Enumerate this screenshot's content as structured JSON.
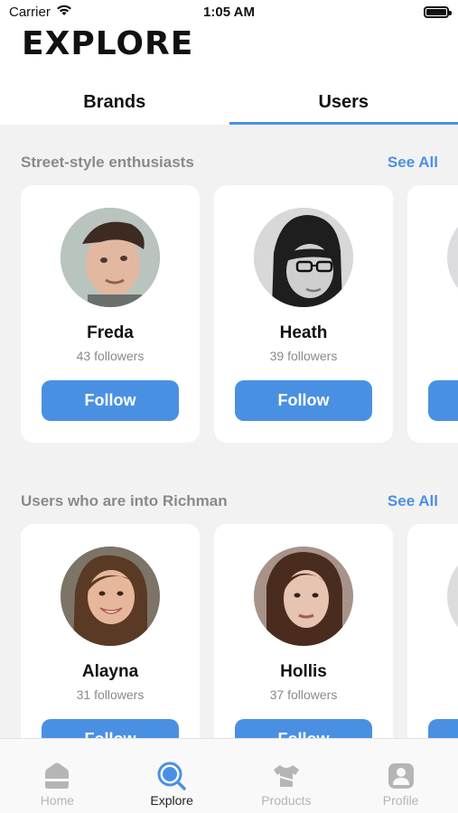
{
  "status_bar": {
    "carrier": "Carrier",
    "time": "1:05 AM"
  },
  "header": {
    "title": "EXPLORE"
  },
  "tabs": [
    {
      "label": "Brands",
      "active": false
    },
    {
      "label": "Users",
      "active": true
    }
  ],
  "sections": [
    {
      "title": "Street-style enthusiasts",
      "see_all": "See All",
      "users": [
        {
          "name": "Freda",
          "followers": "43 followers",
          "button": "Follow"
        },
        {
          "name": "Heath",
          "followers": "39 followers",
          "button": "Follow"
        },
        {
          "name": "",
          "followers": "",
          "button": ""
        }
      ]
    },
    {
      "title": "Users who are into Richman",
      "see_all": "See All",
      "users": [
        {
          "name": "Alayna",
          "followers": "31 followers",
          "button": "Follow"
        },
        {
          "name": "Hollis",
          "followers": "37 followers",
          "button": "Follow"
        },
        {
          "name": "",
          "followers": "",
          "button": ""
        }
      ]
    }
  ],
  "tabbar": [
    {
      "label": "Home",
      "icon": "home-icon",
      "active": false
    },
    {
      "label": "Explore",
      "icon": "search-icon",
      "active": true
    },
    {
      "label": "Products",
      "icon": "shirt-icon",
      "active": false
    },
    {
      "label": "Profile",
      "icon": "profile-icon",
      "active": false
    }
  ],
  "colors": {
    "accent": "#4a90e2",
    "background": "#f2f2f2",
    "muted": "#8a8a8a"
  }
}
